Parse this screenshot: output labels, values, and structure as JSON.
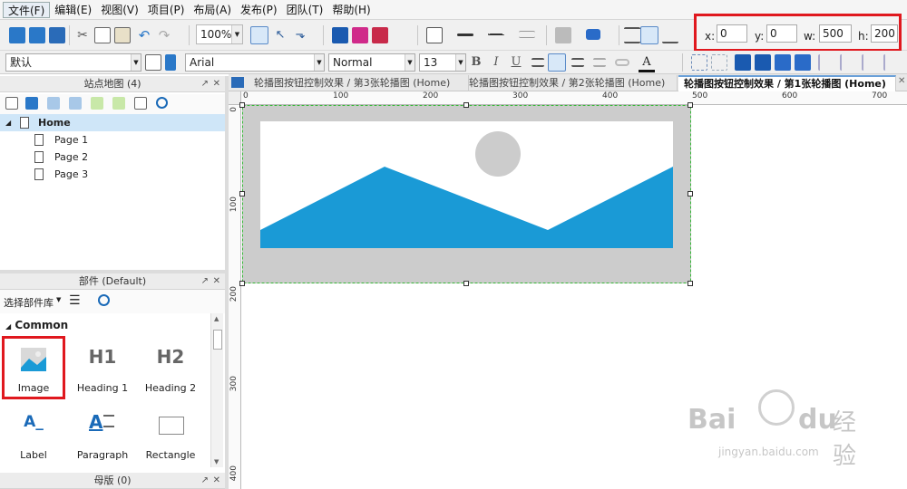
{
  "menu": [
    "文件(F)",
    "编辑(E)",
    "视图(V)",
    "项目(P)",
    "布局(A)",
    "发布(P)",
    "团队(T)",
    "帮助(H)"
  ],
  "toolbar": {
    "zoom": "100%",
    "geometry": {
      "x_label": "x:",
      "x": "0",
      "y_label": "y:",
      "y": "0",
      "w_label": "w:",
      "w": "500",
      "h_label": "h:",
      "h": "200"
    }
  },
  "format_bar": {
    "style": "默认",
    "font": "Arial",
    "weight": "Normal",
    "size": "13",
    "bold": "B",
    "italic": "I",
    "underline": "U",
    "font_color": "A"
  },
  "sitemap": {
    "title": "站点地图 (4)",
    "root": "Home",
    "pages": [
      "Page 1",
      "Page 2",
      "Page 3"
    ]
  },
  "widgets_panel": {
    "title": "部件 (Default)",
    "library_select": "选择部件库",
    "section": "Common",
    "items": [
      {
        "label": "Image",
        "glyph": ""
      },
      {
        "label": "Heading 1",
        "glyph": "H1"
      },
      {
        "label": "Heading 2",
        "glyph": "H2"
      },
      {
        "label": "Label",
        "glyph": "A_"
      },
      {
        "label": "Paragraph",
        "glyph": "A"
      },
      {
        "label": "Rectangle",
        "glyph": ""
      }
    ]
  },
  "masters_panel": {
    "title": "母版 (0)"
  },
  "tabs": [
    {
      "label": "轮播图按钮控制效果 / 第3张轮播图 (Home)"
    },
    {
      "label": "轮播图按钮控制效果 / 第2张轮播图 (Home)"
    },
    {
      "label": "轮播图按钮控制效果 / 第1张轮播图 (Home)"
    }
  ],
  "ruler": {
    "h": [
      "0",
      "100",
      "200",
      "300",
      "400",
      "500",
      "600",
      "700"
    ],
    "v": [
      "0",
      "100",
      "200",
      "300",
      "400"
    ]
  },
  "watermark": {
    "brand": "Bai",
    "brand_suffix": "du",
    "brand_cn": "经验",
    "url": "jingyan.baidu.com"
  },
  "colors": {
    "accent_blue": "#1a9ad6",
    "placeholder_gray": "#cccccc",
    "highlight_red": "#e0181e"
  }
}
